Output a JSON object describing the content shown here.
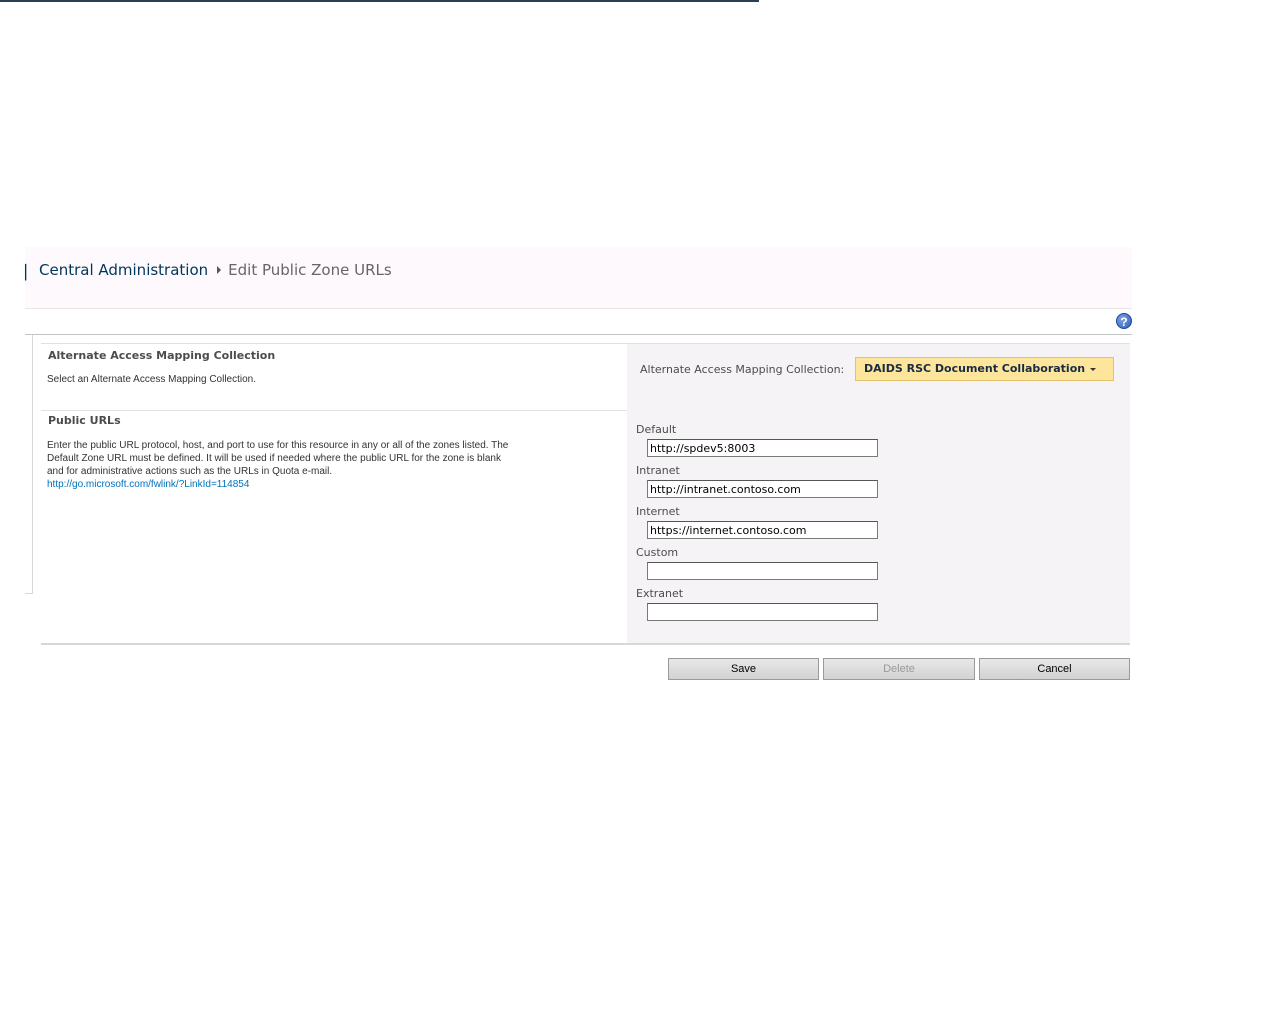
{
  "breadcrumb": {
    "root": "Central Administration",
    "current": "Edit Public Zone URLs"
  },
  "help_icon": {
    "glyph": "?"
  },
  "sections": {
    "collection": {
      "title": "Alternate Access Mapping Collection",
      "description": "Select an Alternate Access Mapping Collection.",
      "field_label": "Alternate Access Mapping Collection:",
      "selected_value": "DAIDS RSC Document Collaboration"
    },
    "public_urls": {
      "title": "Public URLs",
      "description": "Enter the public URL protocol, host, and port to use for this resource in any or all of the zones listed.  The Default Zone URL must be defined.  It will be used if needed where the public URL for the zone is blank and for administrative actions such as the URLs in Quota e-mail.",
      "link": "http://go.microsoft.com/fwlink/?LinkId=114854",
      "zones": [
        {
          "label": "Default",
          "value": "http://spdev5:8003"
        },
        {
          "label": "Intranet",
          "value": "http://intranet.contoso.com"
        },
        {
          "label": "Internet",
          "value": "https://internet.contoso.com"
        },
        {
          "label": "Custom",
          "value": ""
        },
        {
          "label": "Extranet",
          "value": ""
        }
      ]
    }
  },
  "buttons": {
    "save": "Save",
    "delete": "Delete",
    "cancel": "Cancel"
  },
  "colors": {
    "link": "#0072bc",
    "dropdown_bg": "#fde69b",
    "panel_bg": "#f6f3f6",
    "title_band": "#fdf9fd"
  }
}
